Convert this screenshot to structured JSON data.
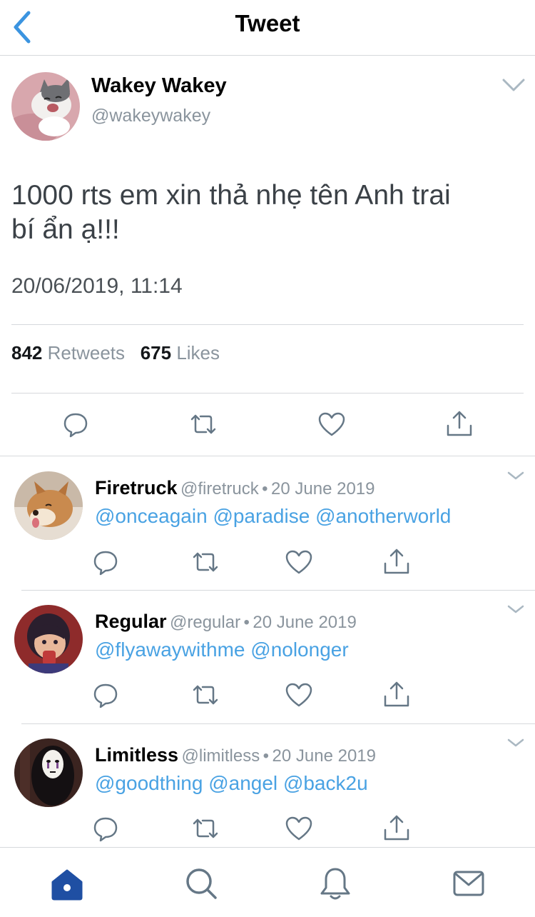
{
  "header": {
    "title": "Tweet",
    "back_icon": "chevron-left-icon"
  },
  "tweet": {
    "name": "Wakey Wakey",
    "handle": "@wakeywakey",
    "text_line1": "1000 rts em xin thả nhẹ tên Anh trai",
    "text_line2": "bí ẩn ạ!!!",
    "timestamp": "20/06/2019, 11:14",
    "retweets_count": "842",
    "retweets_label": "Retweets",
    "likes_count": "675",
    "likes_label": "Likes"
  },
  "replies": [
    {
      "name": "Firetruck",
      "handle": "@firetruck",
      "separator": "•",
      "date": "20 June 2019",
      "mentions": [
        "@onceagain",
        "@paradise",
        "@anotherworld"
      ]
    },
    {
      "name": "Regular",
      "handle": "@regular",
      "separator": "•",
      "date": "20 June 2019",
      "mentions": [
        "@flyawaywithme",
        "@nolonger"
      ]
    },
    {
      "name": "Limitless",
      "handle": "@limitless",
      "separator": "•",
      "date": "20 June 2019",
      "mentions": [
        "@goodthing",
        "@angel",
        "@back2u"
      ]
    }
  ],
  "tabbar": {
    "items": [
      "home-icon",
      "search-icon",
      "notifications-icon",
      "messages-icon"
    ]
  },
  "colors": {
    "accent": "#49a2e3",
    "tab_active": "#1f4fa3",
    "icon_gray": "#657786",
    "divider": "#d6d9dc"
  }
}
